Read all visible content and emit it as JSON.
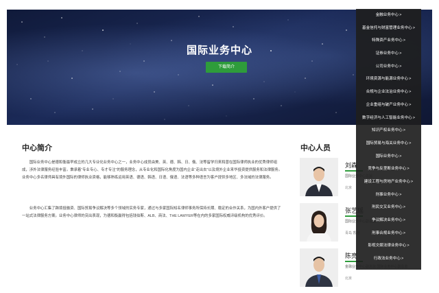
{
  "hero": {
    "title": "国际业务中心",
    "button_label": "下载简介"
  },
  "intro": {
    "title": "中心简介",
    "paragraphs": [
      "国际业务中心是德和衡最早成立的几大专业化业务中心之一，业务中心成员由美、英、德、韩、日、俄、法等留学归来和曾在国际律师执业的优秀律师组成，涉外法律服务经验丰富。秉承着“专业专心、专才专注”的服务理念，从专业化和国际化角度为国内企业“走出去”以及境外企业来华投资提供服务和法律服务。业务中心多名律师具有境外国际的律师执业资格，能够熟练运用英语、德语、韩语、日语、俄语、法语等多种语言为客户提供多地区、多法域的法律服务。",
      "业务中心汇集了跨境投融资、国际贸易争议解决等多个领域的实务专家，通过与多家国际知名律师事务所保持长期、稳定的合作关系，为国内外客户提供了一站式法律服务方案。业务中心律师的突出表现，为德和衡赢得包括钱伯斯、ALB、商法、THE LAWYER等在内的多家国际权威评级机构的优秀评价。"
    ]
  },
  "people": {
    "title": "中心人员",
    "members": [
      {
        "name": "刘森",
        "role": "国际业务中心总监",
        "city": "北京"
      },
      {
        "name": "张艺瑶",
        "role": "国际业务中心副总监",
        "city": "青岛 香港"
      },
      {
        "name": "陈亮",
        "role": "金融业务中心副总监 国际业务中心副总监",
        "city": "北京"
      }
    ]
  },
  "dropdown": {
    "items": [
      "金融业务中心",
      "基金信托与财富管理业务中心",
      "特殊资产业务中心",
      "证券业务中心",
      "公司业务中心",
      "环境资源与能源业务中心",
      "合规与企业法治业务中心",
      "企业重组与破产业务中心",
      "数字经济与人工智能业务中心",
      "知识产权业务中心",
      "国际贸易与海关业务中心",
      "国际业务中心",
      "竞争与反垄断业务中心",
      "建设工程与房地产业务中心",
      "刑事业务中心",
      "刑民交叉业务中心",
      "争议解决业务中心",
      "刑事合规业务中心",
      "影视文娱法律业务中心",
      "行政法业务中心"
    ],
    "suffix": ">"
  }
}
